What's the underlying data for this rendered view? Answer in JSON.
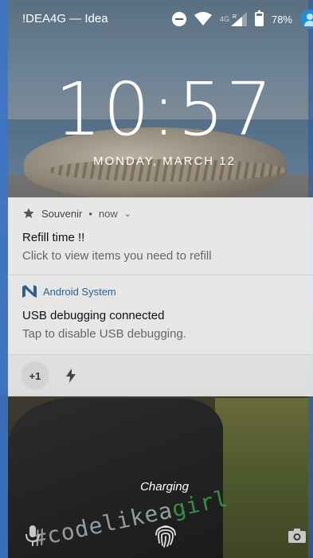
{
  "status_bar": {
    "carrier": "!DEA4G — Idea",
    "network_type": "4G",
    "roaming": "R",
    "battery_percent": "78%",
    "icons": [
      "dnd-icon",
      "wifi-icon",
      "signal-icon",
      "battery-icon",
      "avatar-icon"
    ]
  },
  "lockscreen": {
    "time": "10:57",
    "date": "MONDAY, MARCH 12"
  },
  "notifications": [
    {
      "app": "Souvenir",
      "separator": "•",
      "time": "now",
      "icon": "star-icon",
      "title": "Refill time !!",
      "body": "Click to view items you need to refill"
    },
    {
      "app": "Android System",
      "icon": "android-n-icon",
      "title": "USB debugging connected",
      "body": "Tap to disable USB debugging."
    }
  ],
  "overflow": {
    "count_label": "+1",
    "icon": "bolt-icon"
  },
  "bottom": {
    "charging_label": "Charging",
    "icons": [
      "mic-icon",
      "fingerprint-icon",
      "camera-icon"
    ]
  },
  "wallpaper_text": {
    "main": "#codelikea",
    "accent": "girl"
  },
  "colors": {
    "notification_bg": "#f0f0f0",
    "android_app_name": "#2f5f8f",
    "avatar": "#1e8fd8",
    "edge_strip": "#3b74c8"
  }
}
